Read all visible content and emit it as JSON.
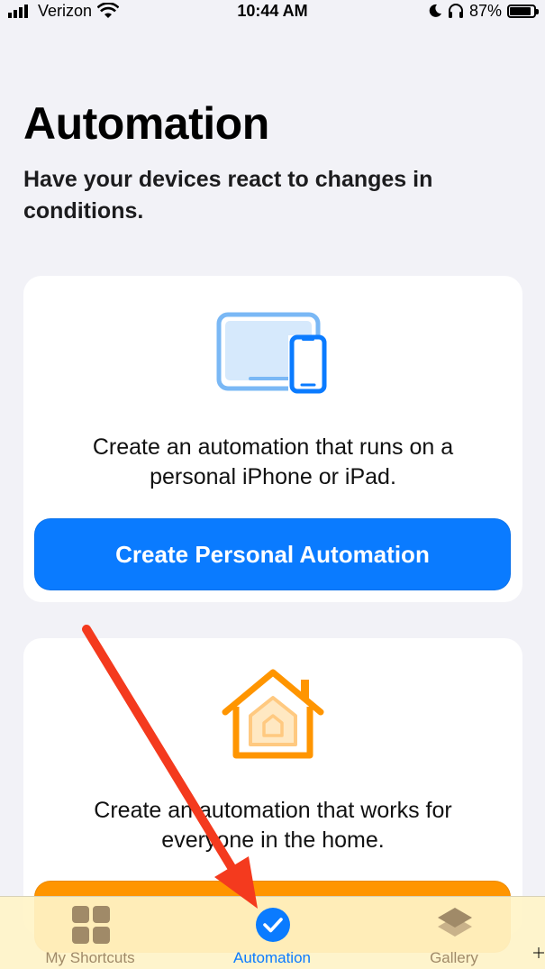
{
  "status_bar": {
    "carrier": "Verizon",
    "time": "10:44 AM",
    "battery": "87%",
    "battery_level": 0.87
  },
  "header": {
    "title": "Automation",
    "subtitle": "Have your devices react to changes in conditions."
  },
  "cards": {
    "personal": {
      "icon": "devices-icon",
      "description_line1": "Create an automation that runs on a",
      "description_line2": "personal iPhone or iPad.",
      "button_label": "Create Personal Automation",
      "button_color": "#0a7bff"
    },
    "home": {
      "icon": "home-icon",
      "description_line1": "Create an automation that works for",
      "description_line2": "everyone in the home.",
      "button_color": "#ff9500"
    }
  },
  "tab_bar": {
    "tabs": [
      {
        "label": "My Shortcuts",
        "icon": "grid-icon",
        "selected": false
      },
      {
        "label": "Automation",
        "icon": "automation-check-icon",
        "selected": true
      },
      {
        "label": "Gallery",
        "icon": "layers-icon",
        "selected": false
      }
    ],
    "accent_color": "#0a7bff",
    "inactive_color": "#a08a68"
  },
  "annotation": {
    "arrow_color": "#f43a1e"
  }
}
